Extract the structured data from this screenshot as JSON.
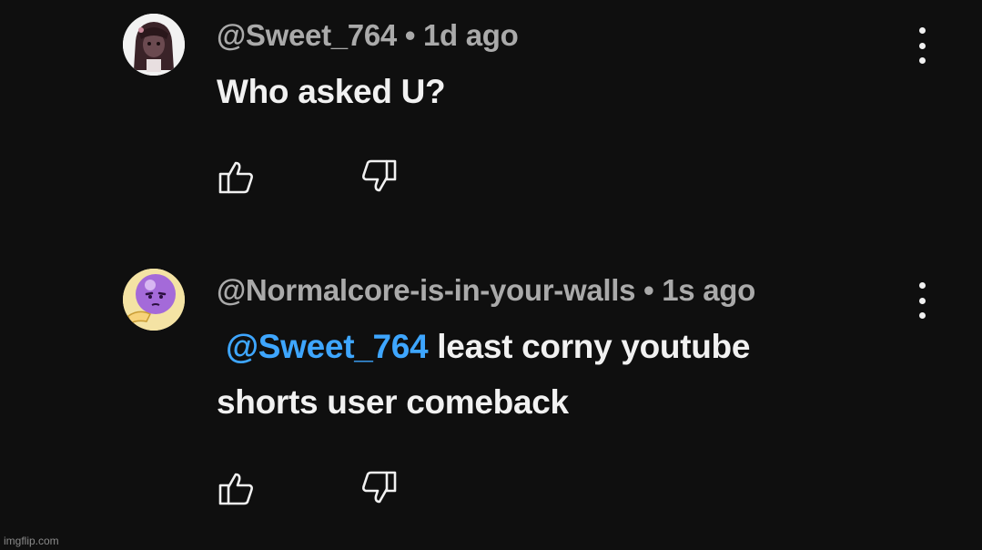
{
  "comments": [
    {
      "handle": "@Sweet_764",
      "separator": " • ",
      "time": "1d ago",
      "text": "Who asked U?"
    },
    {
      "handle": "@Normalcore-is-in-your-walls",
      "separator": " • ",
      "time": "1s ago",
      "mention": "@Sweet_764",
      "text_line1": " least corny youtube",
      "text_line2": "shorts user comeback"
    }
  ],
  "icons": {
    "like": "thumbs-up-icon",
    "dislike": "thumbs-down-icon",
    "more": "more-vert-icon"
  },
  "colors": {
    "background": "#0f0f0f",
    "meta_text": "#aaaaaa",
    "body_text": "#f1f1f1",
    "mention": "#3ea6ff"
  },
  "watermark": "imgflip.com"
}
